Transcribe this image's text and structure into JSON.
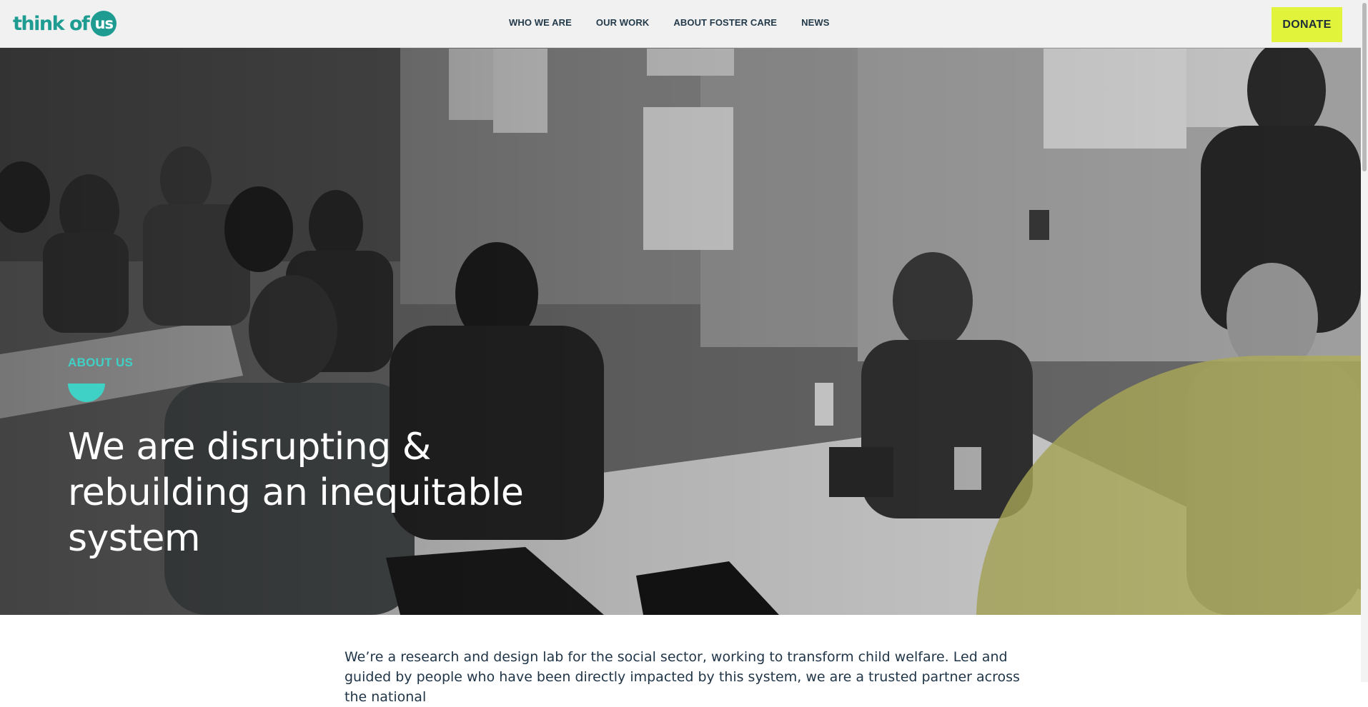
{
  "brand": {
    "logo_word": "think of",
    "logo_mark": "us",
    "accent_teal": "#1f9c92",
    "accent_mint": "#3fd1c5",
    "accent_lime": "#e1f33b",
    "accent_olive": "#b8b65f"
  },
  "nav": {
    "items": [
      "WHO WE ARE",
      "OUR WORK",
      "ABOUT FOSTER CARE",
      "NEWS"
    ],
    "donate_label": "DONATE"
  },
  "hero": {
    "eyebrow": "ABOUT US",
    "title": "We are disrupting & rebuilding an inequitable system",
    "photo_icon": "group-meeting-photo",
    "decor_icon": "half-circle-icon"
  },
  "intro": {
    "text": "We’re a research and design lab for the social sector, working to transform child welfare. Led and guided by people who have been directly impacted by this system, we are a trusted partner across the national"
  }
}
